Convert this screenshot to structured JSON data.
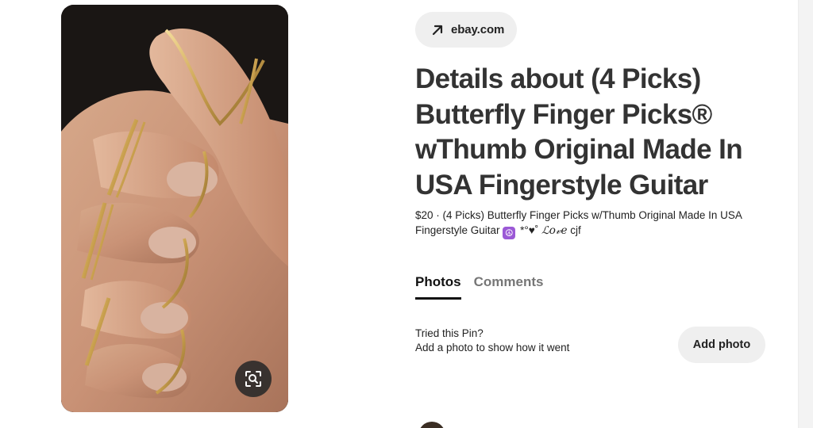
{
  "source": {
    "label": "ebay.com",
    "icon": "arrow-up-right-icon"
  },
  "pin": {
    "title": "Details about (4 Picks) Butterfly Finger Picks® wThumb Original Made In USA Fingerstyle Guitar",
    "description_text": "$20 · (4 Picks) Butterfly Finger Picks w/Thumb Original Made In USA Fingerstyle Guitar",
    "description_emoji": "☮",
    "description_symbols": "*°♥˚",
    "description_love": "ℒ𝑜𝓋𝑒",
    "description_tail": "cjf"
  },
  "tabs": [
    {
      "label": "Photos",
      "active": true
    },
    {
      "label": "Comments",
      "active": false
    }
  ],
  "tried": {
    "question": "Tried this Pin?",
    "prompt": "Add a photo to show how it went",
    "button_label": "Add photo"
  },
  "image": {
    "lens_icon": "visual-search-icon"
  },
  "colors": {
    "chip_bg": "#efefef",
    "title": "#333333",
    "peace_bg": "#9b59d6"
  }
}
